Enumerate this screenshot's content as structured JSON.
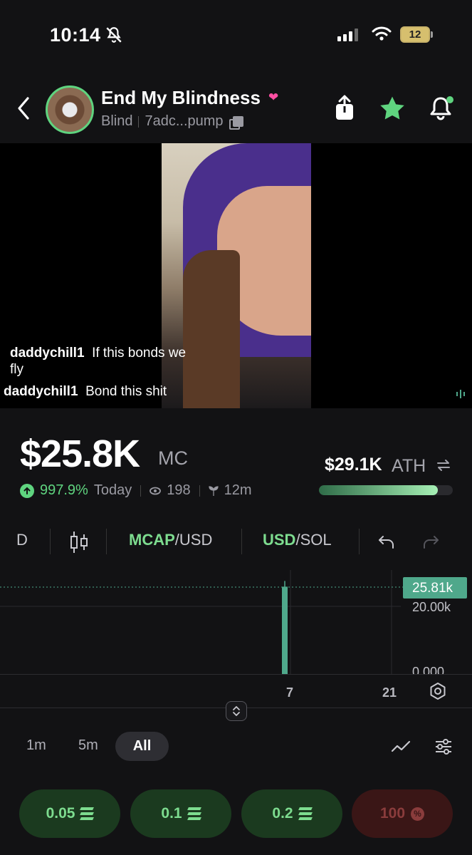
{
  "status_bar": {
    "time": "10:14",
    "battery": "12"
  },
  "header": {
    "title": "End My Blindness",
    "ticker": "Blind",
    "contract": "7adc...pump"
  },
  "chat": [
    {
      "user": "daddychill1",
      "message_line1": "If this bonds we",
      "message_line2": "fly"
    },
    {
      "user": "daddychill1",
      "message_line1": "Bond this shit"
    }
  ],
  "market": {
    "cap": "$25.8K",
    "cap_unit": "MC",
    "change": "997.9%",
    "change_period": "Today",
    "viewers": "198",
    "age": "12m",
    "ath": "$29.1K",
    "ath_unit": "ATH",
    "ath_progress": 0.887
  },
  "chart_toolbar": {
    "interval": "D",
    "mcap_label": "MCAP",
    "mcap_suffix": "/USD",
    "usd_label": "USD",
    "usd_suffix": "/SOL"
  },
  "chart": {
    "current_label": "25.81k",
    "y_ticks": [
      "20.00k",
      "0.000"
    ],
    "x_ticks": [
      "7",
      "21"
    ]
  },
  "chart_data": {
    "type": "candlestick",
    "y_unit": "USD market cap",
    "current_value": 25.81,
    "y_ticks": [
      0,
      20
    ],
    "x_ticks": [
      "7",
      "21"
    ],
    "candles": [
      {
        "x": "7",
        "open": 0,
        "close": 25.81,
        "high": 27.5,
        "low": 0
      }
    ]
  },
  "timeframes": {
    "t1": "1m",
    "t2": "5m",
    "t3": "All",
    "active": "All"
  },
  "buy_buttons": [
    "0.05",
    "0.1",
    "0.2"
  ],
  "sell_button": "100",
  "colors": {
    "accent": "#5fd47f",
    "candle": "#4fa88b",
    "sell": "#8a3c3c",
    "heart": "#ff4fa3"
  }
}
